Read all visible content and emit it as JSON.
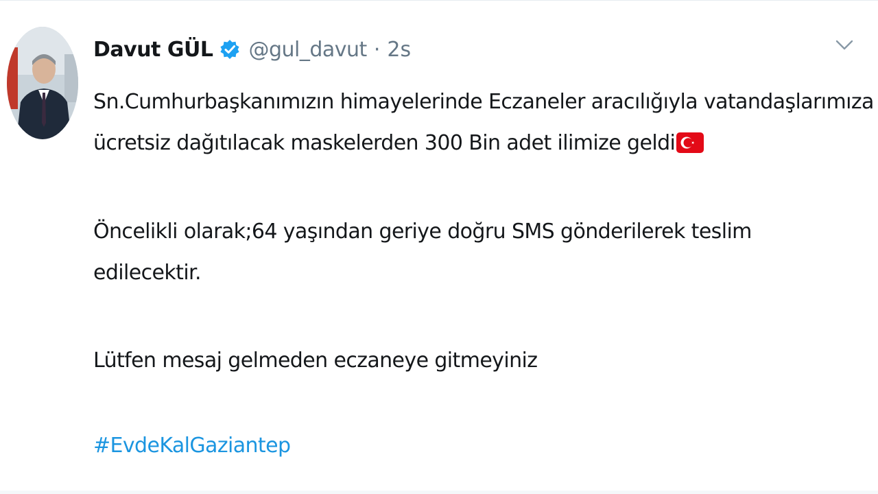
{
  "tweet": {
    "display_name": "Davut GÜL",
    "handle": "@gul_davut",
    "separator": "·",
    "time": "2s",
    "icons": {
      "verified": "verified-badge-icon",
      "caret": "chevron-down-icon",
      "flag": "turkey-flag-emoji-icon"
    },
    "colors": {
      "link": "#1b95e0",
      "verified": "#1da1f2",
      "secondary_text": "#657786"
    },
    "text": {
      "line1": "Sn.Cumhurbaşkanımızın himayelerinde Eczaneler aracılığıyla vatandaşlarımıza",
      "line2": "ücretsiz dağıtılacak maskelerden 300 Bin adet ilimize geldi",
      "para2_line1": "Öncelikli olarak;64 yaşından geriye doğru SMS gönderilerek teslim",
      "para2_line2": "edilecektir.",
      "para3": "Lütfen mesaj gelmeden eczaneye gitmeyiniz",
      "hashtag": "#EvdeKalGaziantep"
    }
  }
}
